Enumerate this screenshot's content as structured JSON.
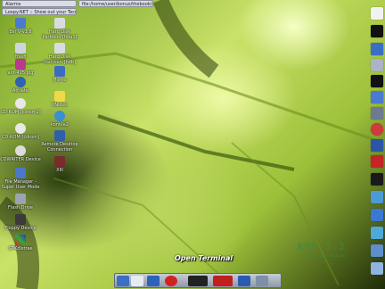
{
  "window_tabs": [
    {
      "label": "Alarms"
    },
    {
      "label": "file:/home/user/bonus/thebook/new/..."
    },
    {
      "label": "Loopy.NET :: Show out your Tecno..."
    }
  ],
  "desktop_icons": [
    {
      "label": "Bin V-v1.8"
    },
    {
      "label": "Hard Disk Partition [hda1]"
    },
    {
      "label": "Trash"
    },
    {
      "label": "Hard Disk Partition [hdb]"
    },
    {
      "label": "ant-415.jpg"
    },
    {
      "label": "Home"
    },
    {
      "label": "Athlete"
    },
    {
      "label": "KNotes"
    },
    {
      "label": "CD-ROM [cdrom1]"
    },
    {
      "label": "kontile2"
    },
    {
      "label": "CD-ROM [cdrom]"
    },
    {
      "label": "Remote Desktop Connection"
    },
    {
      "label": "CDWRITER Device"
    },
    {
      "label": "XIII"
    },
    {
      "label": "File Manager - Super User Mode"
    },
    {
      "label": "Flash Drive"
    },
    {
      "label": "Floppy Device"
    },
    {
      "label": "GTKdistree"
    }
  ],
  "tooltip": "Open Terminal",
  "wallpaper_brand": {
    "title": "KDE 3.3",
    "subtitle": "conquer your desktop"
  },
  "taskbar": {
    "buttons": [
      "kmenu",
      "arrow",
      "konqueror",
      "opera",
      "terminal",
      "mozilla-mb",
      "kde-sync",
      "shell"
    ]
  },
  "right_tray": [
    "tux",
    "tux2",
    "folder",
    "disk",
    "tux3",
    "desktop",
    "sound",
    "ie",
    "vlc",
    "cmd",
    "mb",
    "pen",
    "monitor",
    "network",
    "battery",
    "clock"
  ]
}
